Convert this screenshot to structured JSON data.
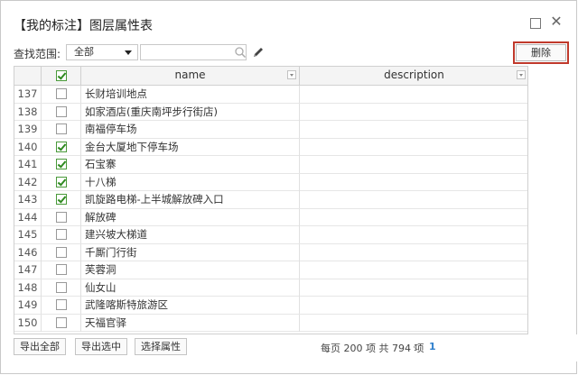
{
  "window": {
    "title": "【我的标注】图层属性表"
  },
  "toolbar": {
    "scope_label": "查找范围:",
    "scope_value": "全部",
    "search_placeholder": "",
    "delete_label": "删除"
  },
  "table": {
    "columns": [
      "name",
      "description"
    ],
    "rows": [
      {
        "num": "137",
        "checked": false,
        "name": "长财培训地点",
        "description": ""
      },
      {
        "num": "138",
        "checked": false,
        "name": "如家酒店(重庆南坪步行街店)",
        "description": ""
      },
      {
        "num": "139",
        "checked": false,
        "name": "南福停车场",
        "description": ""
      },
      {
        "num": "140",
        "checked": true,
        "name": "金台大厦地下停车场",
        "description": ""
      },
      {
        "num": "141",
        "checked": true,
        "name": "石宝寨",
        "description": ""
      },
      {
        "num": "142",
        "checked": true,
        "name": "十八梯",
        "description": ""
      },
      {
        "num": "143",
        "checked": true,
        "name": "凯旋路电梯-上半城解放碑入口",
        "description": ""
      },
      {
        "num": "144",
        "checked": false,
        "name": "解放碑",
        "description": ""
      },
      {
        "num": "145",
        "checked": false,
        "name": "建兴坡大梯道",
        "description": ""
      },
      {
        "num": "146",
        "checked": false,
        "name": "千厮门行街",
        "description": ""
      },
      {
        "num": "147",
        "checked": false,
        "name": "芙蓉洞",
        "description": ""
      },
      {
        "num": "148",
        "checked": false,
        "name": "仙女山",
        "description": ""
      },
      {
        "num": "149",
        "checked": false,
        "name": "武隆喀斯特旅游区",
        "description": ""
      },
      {
        "num": "150",
        "checked": false,
        "name": "天福官驿",
        "description": ""
      }
    ]
  },
  "footer": {
    "export_all": "导出全部",
    "export_selected": "导出选中",
    "choose_attributes": "选择属性",
    "page_info": "每页 200 项  共 794 项",
    "prev_icon": "‹",
    "current_page": "1"
  },
  "colors": {
    "accent_red": "#c0392b",
    "check_green": "#2f8a20",
    "link_blue": "#1a73c8"
  }
}
